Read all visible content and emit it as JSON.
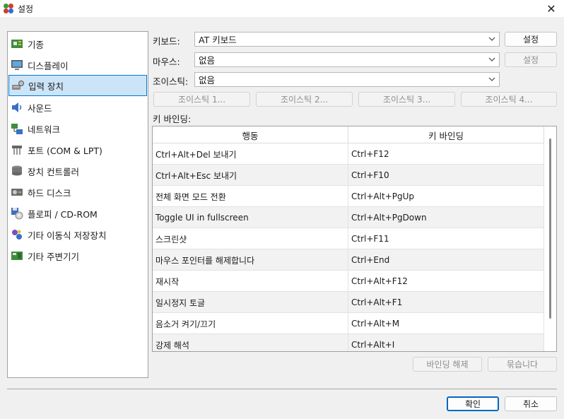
{
  "window": {
    "title": "설정",
    "close_label": "✕"
  },
  "categories": [
    {
      "label": "기종",
      "icon": "motherboard-icon"
    },
    {
      "label": "디스플레이",
      "icon": "display-icon"
    },
    {
      "label": "입력 장치",
      "icon": "input-device-icon",
      "selected": true
    },
    {
      "label": "사운드",
      "icon": "speaker-icon"
    },
    {
      "label": "네트워크",
      "icon": "network-icon"
    },
    {
      "label": "포트 (COM & LPT)",
      "icon": "port-icon"
    },
    {
      "label": "장치 컨트롤러",
      "icon": "controller-icon"
    },
    {
      "label": "하드 디스크",
      "icon": "hard-disk-icon"
    },
    {
      "label": "플로피 / CD-ROM",
      "icon": "floppy-cdrom-icon"
    },
    {
      "label": "기타 이동식 저장장치",
      "icon": "removable-storage-icon"
    },
    {
      "label": "기타 주변기기",
      "icon": "peripherals-icon"
    }
  ],
  "form": {
    "keyboard": {
      "label": "키보드:",
      "value": "AT 키보드",
      "button": "설정"
    },
    "mouse": {
      "label": "마우스:",
      "value": "없음",
      "button": "설정"
    },
    "joystick": {
      "label": "조이스틱:",
      "value": "없음"
    },
    "joystick_buttons": [
      "조이스틱 1...",
      "조이스틱 2...",
      "조이스틱 3...",
      "조이스틱 4..."
    ]
  },
  "bindings": {
    "title": "키 바인딩:",
    "columns": [
      "행동",
      "키 바인딩"
    ],
    "rows": [
      [
        "Ctrl+Alt+Del 보내기",
        "Ctrl+F12"
      ],
      [
        "Ctrl+Alt+Esc 보내기",
        "Ctrl+F10"
      ],
      [
        "전체 화면 모드 전환",
        "Ctrl+Alt+PgUp"
      ],
      [
        "Toggle UI in fullscreen",
        "Ctrl+Alt+PgDown"
      ],
      [
        "스크린샷",
        "Ctrl+F11"
      ],
      [
        "마우스 포인터를 해제합니다",
        "Ctrl+End"
      ],
      [
        "재시작",
        "Ctrl+Alt+F12"
      ],
      [
        "일시정지 토글",
        "Ctrl+Alt+F1"
      ],
      [
        "음소거 켜기/끄기",
        "Ctrl+Alt+M"
      ],
      [
        "강제 해석",
        "Ctrl+Alt+I"
      ]
    ],
    "unbind_button": "바인딩 해제",
    "bind_button": "묶습니다"
  },
  "footer": {
    "ok": "확인",
    "cancel": "취소"
  },
  "colors": {
    "accent": "#0078d7",
    "selected_bg": "#cce4f7",
    "window_bg": "#f0f0f0"
  }
}
